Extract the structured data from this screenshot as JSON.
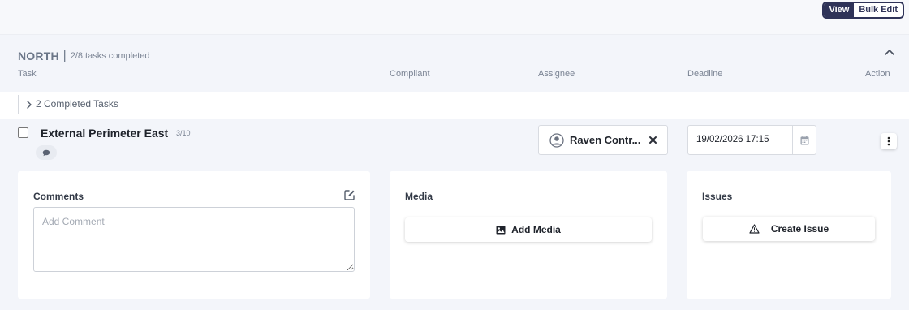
{
  "view_toggle": {
    "view_label": "View",
    "bulk_edit_label": "Bulk Edit",
    "active": "View"
  },
  "section": {
    "title": "NORTH",
    "separator": "|",
    "subtitle": "2/8 tasks completed"
  },
  "columns": {
    "task": "Task",
    "compliant": "Compliant",
    "assignee": "Assignee",
    "deadline": "Deadline",
    "action": "Action"
  },
  "completed_toggle": {
    "label": "2 Completed Tasks"
  },
  "task": {
    "name": "External Perimeter East",
    "count": "3/10",
    "assignee": "Raven Contr...",
    "deadline": "19/02/2026 17:15"
  },
  "comments": {
    "title": "Comments",
    "placeholder": "Add Comment"
  },
  "media": {
    "title": "Media",
    "button": "Add Media"
  },
  "issues": {
    "title": "Issues",
    "button": "Create Issue"
  },
  "colors": {
    "accent": "#2f3358",
    "panel_bg": "#f3f5fa",
    "card_bg": "#ffffff"
  },
  "icons": [
    "chevron-up-icon",
    "chevron-right-icon",
    "comment-icon",
    "user-avatar-icon",
    "close-icon",
    "calendar-icon",
    "kebab-menu-icon",
    "edit-icon",
    "image-icon",
    "warning-icon"
  ]
}
